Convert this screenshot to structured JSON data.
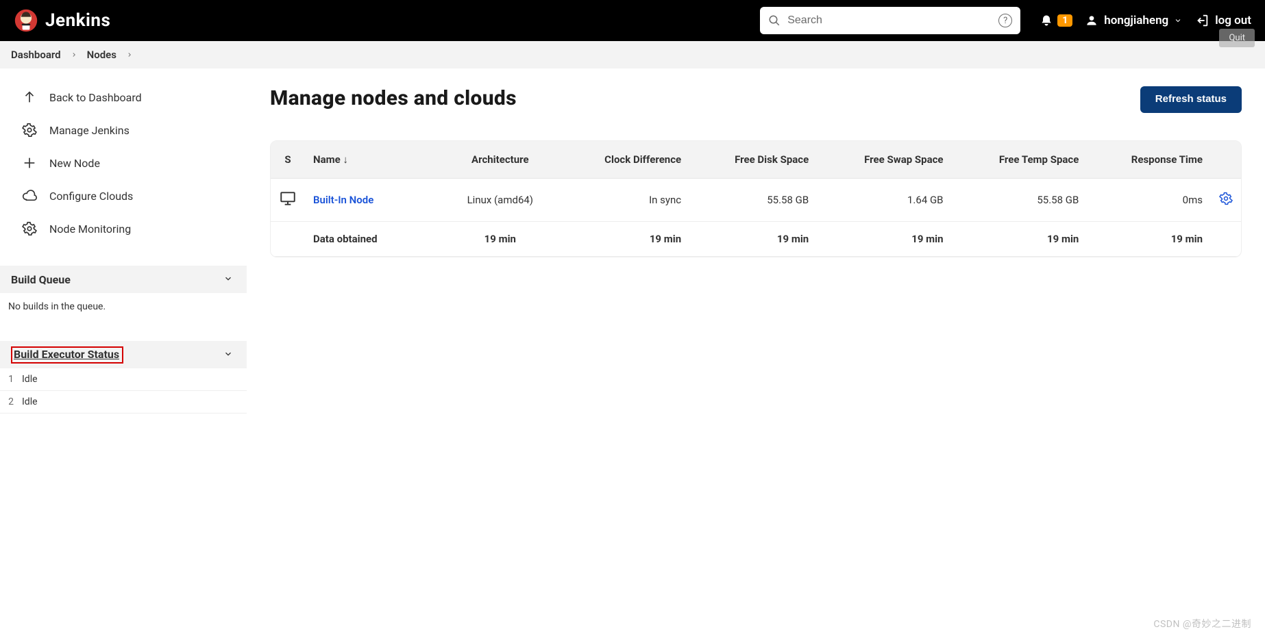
{
  "brand": "Jenkins",
  "header": {
    "search_placeholder": "Search",
    "notif_count": "1",
    "username": "hongjiaheng",
    "logout_label": "log out",
    "quit_tooltip": "Quit"
  },
  "breadcrumbs": [
    {
      "label": "Dashboard"
    },
    {
      "label": "Nodes"
    }
  ],
  "sidebar": {
    "items": [
      {
        "label": "Back to Dashboard",
        "icon": "arrow-up"
      },
      {
        "label": "Manage Jenkins",
        "icon": "gear"
      },
      {
        "label": "New Node",
        "icon": "plus"
      },
      {
        "label": "Configure Clouds",
        "icon": "cloud"
      },
      {
        "label": "Node Monitoring",
        "icon": "gear"
      }
    ]
  },
  "build_queue": {
    "title": "Build Queue",
    "empty_text": "No builds in the queue."
  },
  "executor_status": {
    "title": "Build Executor Status",
    "executors": [
      {
        "num": "1",
        "state": "Idle"
      },
      {
        "num": "2",
        "state": "Idle"
      }
    ]
  },
  "page": {
    "title": "Manage nodes and clouds",
    "refresh_label": "Refresh status"
  },
  "table": {
    "headers": {
      "s": "S",
      "name": "Name  ↓",
      "arch": "Architecture",
      "clock": "Clock Difference",
      "disk": "Free Disk Space",
      "swap": "Free Swap Space",
      "temp": "Free Temp Space",
      "resp": "Response Time"
    },
    "rows": [
      {
        "name": "Built-In Node",
        "arch": "Linux (amd64)",
        "clock": "In sync",
        "disk": "55.58 GB",
        "swap": "1.64 GB",
        "temp": "55.58 GB",
        "resp": "0ms"
      }
    ],
    "footer": {
      "label": "Data obtained",
      "arch": "19 min",
      "clock": "19 min",
      "disk": "19 min",
      "swap": "19 min",
      "temp": "19 min",
      "resp": "19 min"
    }
  },
  "watermark": "CSDN @奇妙之二进制"
}
